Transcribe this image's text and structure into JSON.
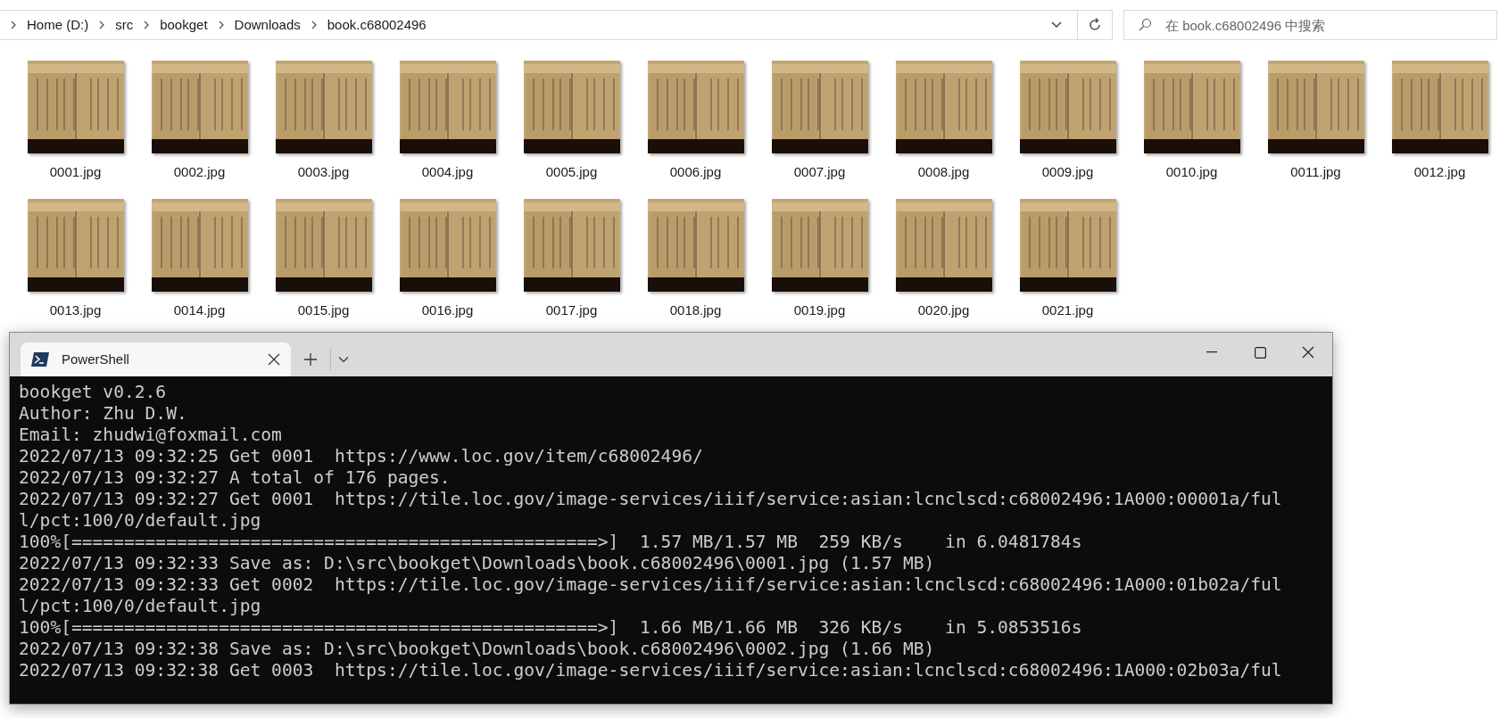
{
  "explorer": {
    "breadcrumbs": [
      "Home (D:)",
      "src",
      "bookget",
      "Downloads",
      "book.c68002496"
    ],
    "search": {
      "placeholder": "在 book.c68002496 中搜索"
    },
    "files": [
      {
        "name": "0001.jpg",
        "kind": "picture"
      },
      {
        "name": "0002.jpg",
        "kind": "picture"
      },
      {
        "name": "0003.jpg",
        "kind": "picture"
      },
      {
        "name": "0004.jpg",
        "kind": "picture"
      },
      {
        "name": "0005.jpg",
        "kind": "picture"
      },
      {
        "name": "0006.jpg",
        "kind": "picture"
      },
      {
        "name": "0007.jpg",
        "kind": "picture"
      },
      {
        "name": "0008.jpg",
        "kind": "picture"
      },
      {
        "name": "0009.jpg",
        "kind": "picture"
      },
      {
        "name": "0010.jpg",
        "kind": "picture"
      },
      {
        "name": "0011.jpg",
        "kind": "picture"
      },
      {
        "name": "0012.jpg",
        "kind": "picture"
      },
      {
        "name": "0013.jpg",
        "kind": "picture"
      },
      {
        "name": "0014.jpg",
        "kind": "picture"
      },
      {
        "name": "0015.jpg",
        "kind": "picture"
      },
      {
        "name": "0016.jpg",
        "kind": "picture"
      },
      {
        "name": "0017.jpg",
        "kind": "picture"
      },
      {
        "name": "0018.jpg",
        "kind": "picture"
      },
      {
        "name": "0019.jpg",
        "kind": "picture"
      },
      {
        "name": "0020.jpg",
        "kind": "picture"
      },
      {
        "name": "0021.jpg",
        "kind": "picture"
      }
    ]
  },
  "terminal": {
    "tabs": [
      {
        "label": "PowerShell",
        "selected": true
      }
    ],
    "lines": [
      "bookget v0.2.6",
      "Author: Zhu D.W.",
      "Email: zhudwi@foxmail.com",
      "2022/07/13 09:32:25 Get 0001  https://www.loc.gov/item/c68002496/",
      "2022/07/13 09:32:27 A total of 176 pages.",
      "2022/07/13 09:32:27 Get 0001  https://tile.loc.gov/image-services/iiif/service:asian:lcnclscd:c68002496:1A000:00001a/ful",
      "l/pct:100/0/default.jpg",
      "100%[==================================================>]  1.57 MB/1.57 MB  259 KB/s    in 6.0481784s",
      "2022/07/13 09:32:33 Save as: D:\\src\\bookget\\Downloads\\book.c68002496\\0001.jpg (1.57 MB)",
      "2022/07/13 09:32:33 Get 0002  https://tile.loc.gov/image-services/iiif/service:asian:lcnclscd:c68002496:1A000:01b02a/ful",
      "l/pct:100/0/default.jpg",
      "100%[==================================================>]  1.66 MB/1.66 MB  326 KB/s    in 5.0853516s",
      "2022/07/13 09:32:38 Save as: D:\\src\\bookget\\Downloads\\book.c68002496\\0002.jpg (1.66 MB)",
      "2022/07/13 09:32:38 Get 0003  https://tile.loc.gov/image-services/iiif/service:asian:lcnclscd:c68002496:1A000:02b03a/ful"
    ]
  }
}
